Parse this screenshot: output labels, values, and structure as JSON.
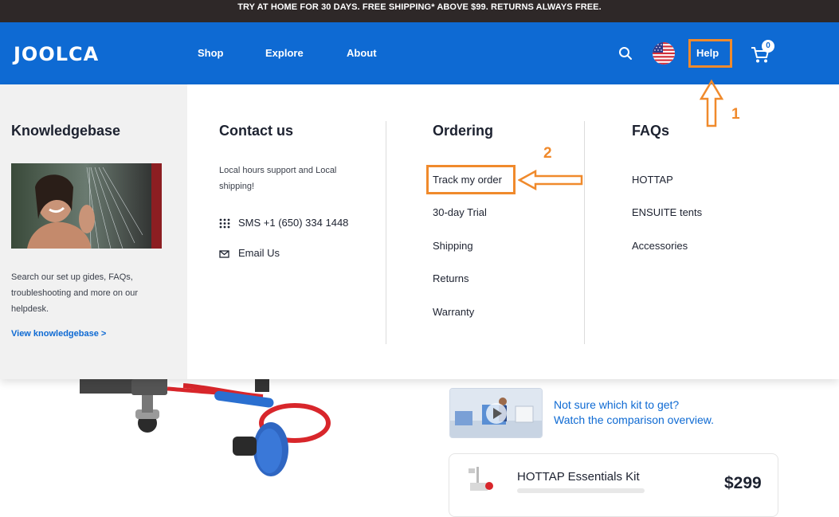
{
  "announcement": "TRY AT HOME FOR 30 DAYS. FREE SHIPPING* ABOVE $99. RETURNS ALWAYS FREE.",
  "nav": {
    "logo": "JOOLCA",
    "links": [
      "Shop",
      "Explore",
      "About"
    ],
    "help": "Help",
    "cart_count": "0",
    "search_icon": "search-icon",
    "flag_icon": "us-flag-icon",
    "cart_icon": "cart-icon"
  },
  "knowledgebase": {
    "title": "Knowledgebase",
    "text": "Search our set up gides, FAQs, troubleshooting and more on our helpdesk.",
    "link": "View knowledgebase >"
  },
  "contact": {
    "title": "Contact us",
    "text": "Local hours support and Local shipping!",
    "sms": "SMS +1 (650) 334 1448",
    "email": "Email Us"
  },
  "ordering": {
    "title": "Ordering",
    "items": [
      "Track my order",
      "30-day Trial",
      "Shipping",
      "Returns",
      "Warranty"
    ]
  },
  "faqs": {
    "title": "FAQs",
    "items": [
      "HOTTAP",
      "ENSUITE tents",
      "Accessories"
    ]
  },
  "annotations": {
    "step1": "1",
    "step2": "2"
  },
  "video": {
    "line1": "Not sure which kit to get?",
    "line2": "Watch the comparison overview."
  },
  "kit": {
    "name": "HOTTAP Essentials Kit",
    "price": "$299"
  },
  "colors": {
    "brand_blue": "#0e6ad3",
    "annotation_orange": "#f08a2c",
    "topbar": "#2e2828"
  }
}
